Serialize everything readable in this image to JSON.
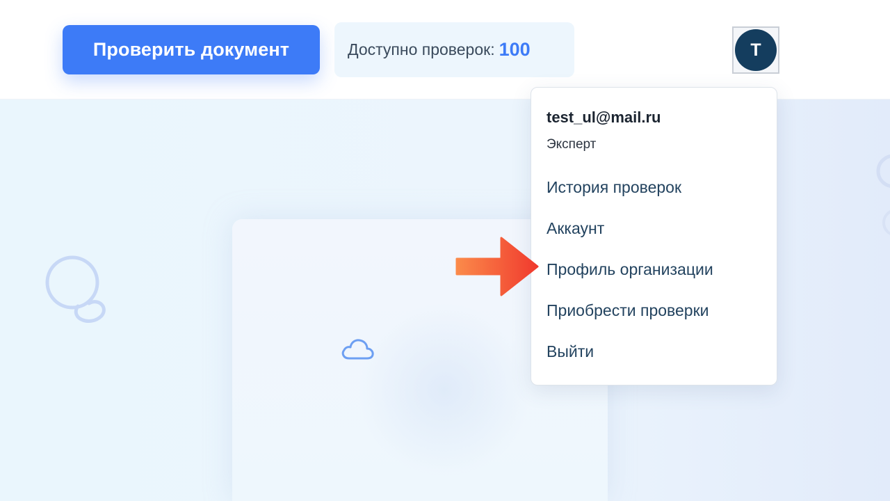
{
  "header": {
    "check_button_label": "Проверить документ",
    "checks_label": "Доступно проверок:",
    "checks_count": "100",
    "avatar_letter": "T"
  },
  "dropdown": {
    "email": "test_ul@mail.ru",
    "role": "Эксперт",
    "items": [
      {
        "label": "История проверок"
      },
      {
        "label": "Аккаунт"
      },
      {
        "label": "Профиль организации"
      },
      {
        "label": "Приобрести проверки"
      },
      {
        "label": "Выйти"
      }
    ]
  },
  "colors": {
    "accent": "#3d7bf7",
    "avatar_bg": "#143d5e",
    "annotation_arrow": "#f24a34"
  },
  "icons": {
    "avatar": "user-avatar",
    "cloud": "cloud-icon",
    "annotation": "arrow-right-icon"
  }
}
